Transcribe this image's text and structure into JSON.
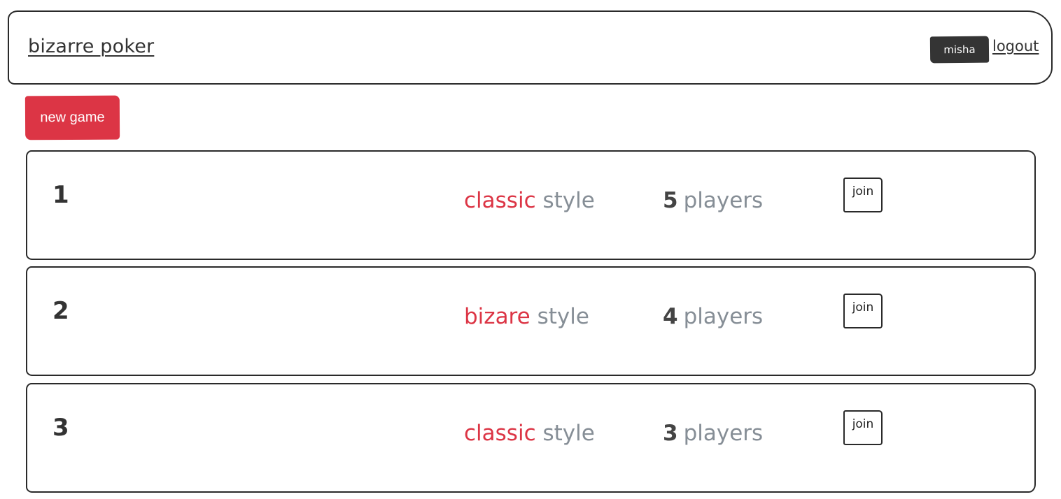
{
  "header": {
    "brand": "bizarre poker",
    "user": "misha",
    "logout_label": "logout"
  },
  "actions": {
    "new_game_label": "new game"
  },
  "games": [
    {
      "id": "1",
      "style": "classic",
      "style_word": "style",
      "players": "5",
      "players_word": "players",
      "join_label": "join"
    },
    {
      "id": "2",
      "style": "bizare",
      "style_word": "style",
      "players": "4",
      "players_word": "players",
      "join_label": "join"
    },
    {
      "id": "3",
      "style": "classic",
      "style_word": "style",
      "players": "3",
      "players_word": "players",
      "join_label": "join"
    }
  ],
  "colors": {
    "accent": "#dc3545",
    "muted": "#868e96",
    "dark": "#343434"
  }
}
